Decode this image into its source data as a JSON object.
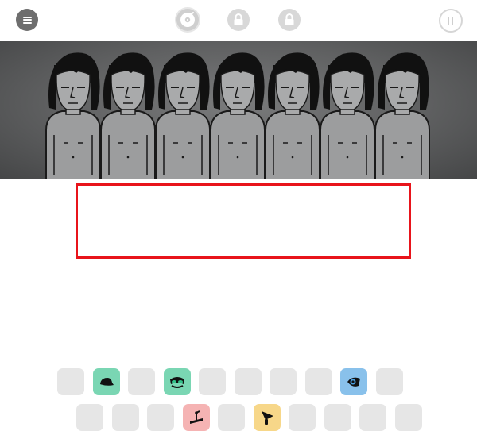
{
  "topbar": {
    "menu_icon": "menu-icon",
    "mode_buttons": [
      "vinyl-record-icon",
      "lock-icon",
      "lock-icon"
    ],
    "pause_icon": "pause-icon"
  },
  "stage": {
    "performer_count": 7,
    "background": "#5f6061"
  },
  "sound_tray": {
    "top_row": [
      {
        "filled": false
      },
      {
        "filled": true,
        "icon": "hat-icon",
        "color": "#33c08a"
      },
      {
        "filled": false
      },
      {
        "filled": true,
        "icon": "goggles-icon",
        "color": "#33c08a"
      },
      {
        "filled": false
      },
      {
        "filled": false
      },
      {
        "filled": false
      },
      {
        "filled": false
      },
      {
        "filled": true,
        "icon": "eye-icon",
        "color": "#4a9fe0"
      },
      {
        "filled": false
      }
    ],
    "bottom_row": [
      {
        "filled": false
      },
      {
        "filled": false
      },
      {
        "filled": false
      },
      {
        "filled": true,
        "icon": "turntable-arm-icon",
        "color": "#f08a8a"
      },
      {
        "filled": false
      },
      {
        "filled": true,
        "icon": "horn-icon",
        "color": "#f2c24a"
      },
      {
        "filled": false
      },
      {
        "filled": false
      },
      {
        "filled": false
      },
      {
        "filled": false
      }
    ]
  }
}
